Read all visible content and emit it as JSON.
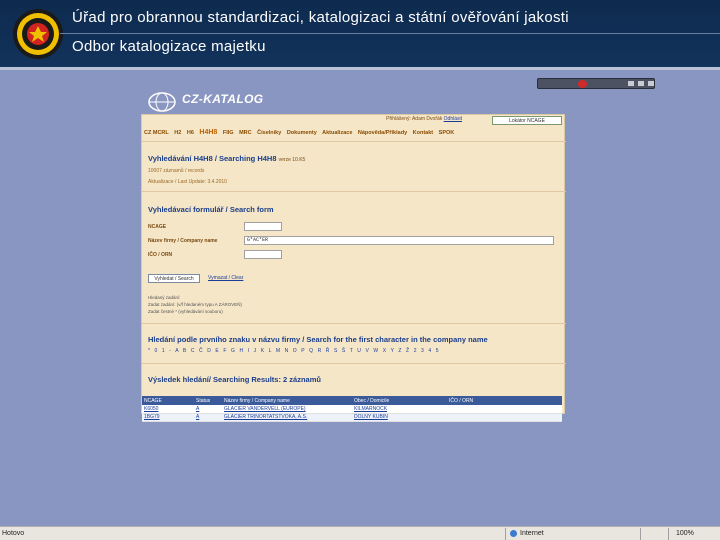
{
  "header": {
    "title": "Úřad pro obrannou standardizaci, katalogizaci a státní ověřování jakosti",
    "subtitle": "Odbor katalogizace majetku"
  },
  "app": {
    "logo_text": "CZ-KATALOG",
    "user_prefix": "Přihlášený: Adam Dvořák",
    "user_link": "Odhlásit",
    "ncage_button": "Lokátor NCAGE"
  },
  "menu": [
    "CZ MCRL",
    "H2",
    "H6",
    "H4H8",
    "FIIG",
    "MRC",
    "Číselníky",
    "Dokumenty",
    "Aktualizace",
    "Nápověda/Příklady",
    "Kontakt",
    "SPOK"
  ],
  "menu_active": "H4H8",
  "search_page": {
    "title": "Vyhledávání H4H8 / Searching H4H8",
    "version": "verze 10.K5",
    "records": "10007 záznamů / records",
    "updated": "Aktualizace / Last Update: 3.4.2010",
    "form_title": "Vyhledávací formulář / Search form",
    "field_ncage": "NCAGE",
    "field_company": "Název firmy / Company name",
    "company_value": "G*AC*ER",
    "field_ico": "IČO / ORN",
    "search_button": "Vyhledat / Search",
    "clear_link": "Vymazat / Clear",
    "hint1": "Hledaný zadání:",
    "hint2": "Zadat zadání: (v/f hledaném typu A ZÁROVEŇ)",
    "hint3": "Zadat čestné * (vyhledávání souboru)",
    "first_char_title": "Hledání podle prvního znaku v názvu firmy / Search for the first character in the company name",
    "alphabet": "* 0 1 - A B C Č D E F G H I J K L M N O P Q R Ř S Š T U V W X Y Z Ž 2 3 4 5"
  },
  "results": {
    "title": "Výsledek hledání/ Searching Results: 2 záznamů",
    "columns": [
      "NCAGE",
      "Status",
      "Název firmy / Company name",
      "Obec / Domicile",
      "IČO / ORN"
    ],
    "rows": [
      [
        "K6050",
        "A",
        "GLACIER VANDERVELL (EUROPE)",
        "KILMARNOCK",
        ""
      ],
      [
        "1BG79",
        "A",
        "GLACIER TRINORTATSTVOKA, A.S.",
        "DOLNY KUBIN",
        ""
      ]
    ]
  },
  "statusbar": {
    "left": "Hotovo",
    "zone": "Internet",
    "zoom": "100%"
  },
  "colors": {
    "header_bg": "#12335c",
    "page_bg": "#8a96c2",
    "panel_bg": "#f5e6c8",
    "table_header": "#3a5a9a"
  }
}
